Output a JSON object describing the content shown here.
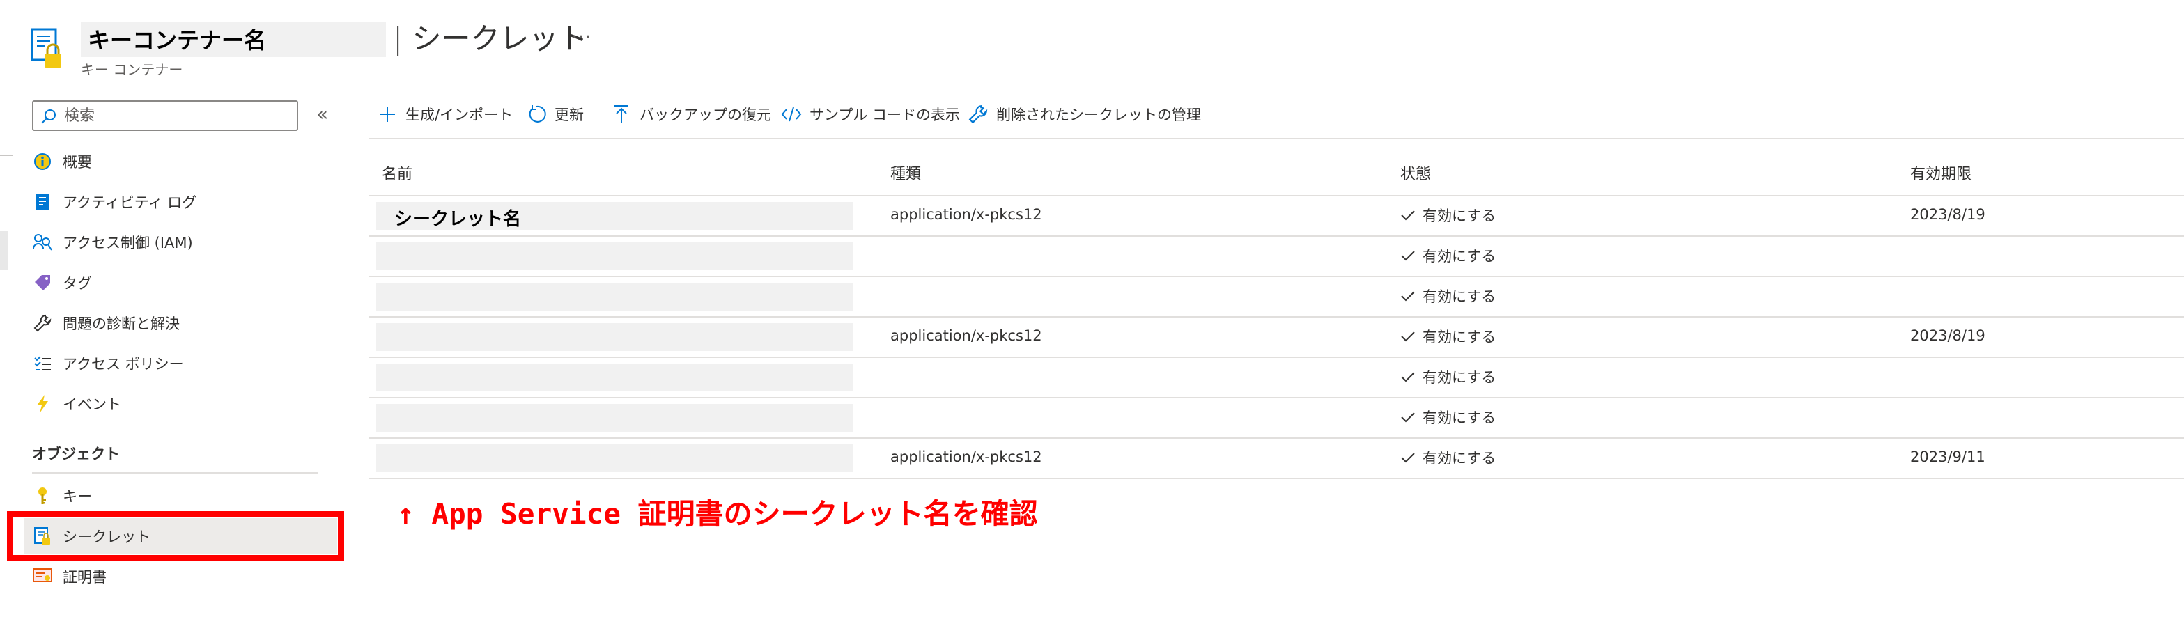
{
  "header": {
    "resource_name": "キーコンテナー名",
    "page_title": "| シークレット",
    "more_label": "···",
    "subtitle": "キー コンテナー"
  },
  "sidebar": {
    "search_placeholder": "検索",
    "collapse_label": "«",
    "items": [
      {
        "label": "概要",
        "icon": "overview-icon"
      },
      {
        "label": "アクティビティ ログ",
        "icon": "activity-log-icon"
      },
      {
        "label": "アクセス制御 (IAM)",
        "icon": "iam-icon"
      },
      {
        "label": "タグ",
        "icon": "tag-icon"
      },
      {
        "label": "問題の診断と解決",
        "icon": "wrench-icon"
      },
      {
        "label": "アクセス ポリシー",
        "icon": "access-policy-icon"
      },
      {
        "label": "イベント",
        "icon": "lightning-icon"
      }
    ],
    "section_label": "オブジェクト",
    "object_items": [
      {
        "label": "キー",
        "icon": "key-icon"
      },
      {
        "label": "シークレット",
        "icon": "secret-icon",
        "selected": true
      },
      {
        "label": "証明書",
        "icon": "certificate-icon"
      }
    ]
  },
  "toolbar": {
    "generate_import": "生成/インポート",
    "refresh": "更新",
    "restore_backup": "バックアップの復元",
    "view_sample_code": "サンプル コードの表示",
    "manage_deleted": "削除されたシークレットの管理"
  },
  "table": {
    "columns": [
      "名前",
      "種類",
      "状態",
      "有効期限"
    ],
    "rows": [
      {
        "name": "シークレット名",
        "type": "application/x-pkcs12",
        "status": "有効にする",
        "expires": "2023/8/19"
      },
      {
        "name": "",
        "type": "",
        "status": "有効にする",
        "expires": ""
      },
      {
        "name": "",
        "type": "",
        "status": "有効にする",
        "expires": ""
      },
      {
        "name": "",
        "type": "application/x-pkcs12",
        "status": "有効にする",
        "expires": "2023/8/19"
      },
      {
        "name": "",
        "type": "",
        "status": "有効にする",
        "expires": ""
      },
      {
        "name": "",
        "type": "",
        "status": "有効にする",
        "expires": ""
      },
      {
        "name": "",
        "type": "application/x-pkcs12",
        "status": "有効にする",
        "expires": "2023/9/11"
      }
    ]
  },
  "annotation": "↑ App Service 証明書のシークレット名を確認",
  "colors": {
    "accent": "#0078d4",
    "highlight": "#ff0000",
    "selected_bg": "#edebe9",
    "mask": "#f1f1f1"
  }
}
